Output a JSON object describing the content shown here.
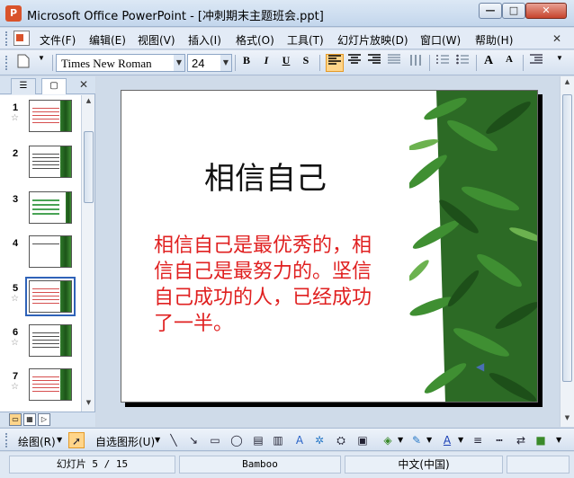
{
  "window": {
    "title": "Microsoft Office PowerPoint - [冲刺期末主题班会.ppt]",
    "app_icon_letter": "P",
    "min_label": "—",
    "max_label": "□",
    "close_label": "✕"
  },
  "menu": {
    "items": [
      "文件(F)",
      "编辑(E)",
      "视图(V)",
      "插入(I)",
      "格式(O)",
      "工具(T)",
      "幻灯片放映(D)",
      "窗口(W)",
      "帮助(H)"
    ],
    "close_label": "✕"
  },
  "format_toolbar": {
    "font_name": "Times New Roman",
    "font_size": "24",
    "bold": "B",
    "italic": "I",
    "underline": "U",
    "shadow": "S",
    "align_active": "left",
    "grow_font": "A",
    "shrink_font": "A"
  },
  "left_panel": {
    "tab_outline_icon": "outline-icon",
    "tab_slides_icon": "slides-icon",
    "close_label": "✕",
    "thumbnails": [
      {
        "num": "1",
        "star": "☆",
        "style": "red"
      },
      {
        "num": "2",
        "star": "",
        "style": "dark"
      },
      {
        "num": "3",
        "star": "",
        "style": "green"
      },
      {
        "num": "4",
        "star": "",
        "style": "dark"
      },
      {
        "num": "5",
        "star": "☆",
        "style": "red"
      },
      {
        "num": "6",
        "star": "☆",
        "style": "dark"
      },
      {
        "num": "7",
        "star": "☆",
        "style": "red"
      }
    ],
    "selected_thumbnail": "5"
  },
  "slide": {
    "title": "相信自己",
    "body": "相信自己是最优秀的，相信自己是最努力的。坚信自己成功的人，已经成功了一半。",
    "title_color": "#111111",
    "body_color": "#e02020"
  },
  "drawing_toolbar": {
    "draw_label": "绘图(R)",
    "autoshapes_label": "自选图形(U)"
  },
  "status": {
    "slide_counter": "幻灯片 5 / 15",
    "design_name": "Bamboo",
    "language": "中文(中国)"
  }
}
